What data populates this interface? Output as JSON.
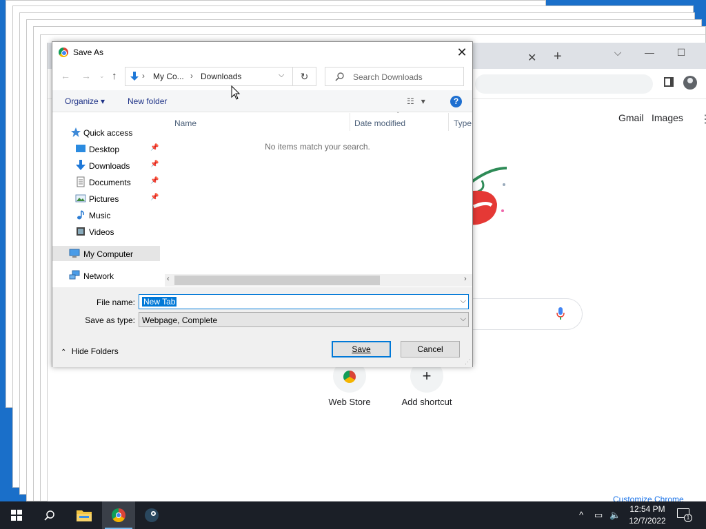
{
  "chrome": {
    "gmail": "Gmail",
    "images": "Images",
    "shortcuts": [
      {
        "label": "Web Store"
      },
      {
        "label": "Add shortcut",
        "glyph": "+"
      }
    ],
    "customize": "Customize Chrome"
  },
  "dialog": {
    "title": "Save As",
    "breadcrumbs": [
      "My Co...",
      "Downloads"
    ],
    "search_placeholder": "Search Downloads",
    "toolbar": {
      "organize": "Organize ▾",
      "new_folder": "New folder",
      "help": "?"
    },
    "nav": [
      {
        "label": "Quick access",
        "icon": "star-icon"
      },
      {
        "label": "Desktop",
        "icon": "desktop-icon",
        "pinned": true
      },
      {
        "label": "Downloads",
        "icon": "download-icon",
        "pinned": true
      },
      {
        "label": "Documents",
        "icon": "documents-icon",
        "pinned": true
      },
      {
        "label": "Pictures",
        "icon": "pictures-icon",
        "pinned": true
      },
      {
        "label": "Music",
        "icon": "music-icon"
      },
      {
        "label": "Videos",
        "icon": "videos-icon"
      },
      {
        "label": "My Computer",
        "icon": "computer-icon",
        "selected": true
      },
      {
        "label": "Network",
        "icon": "network-icon"
      }
    ],
    "columns": [
      "Name",
      "Date modified",
      "Type"
    ],
    "empty_message": "No items match your search.",
    "file_name_label": "File name:",
    "file_name_value": "New Tab",
    "save_type_label": "Save as type:",
    "save_type_value": "Webpage, Complete",
    "hide_folders": "Hide Folders",
    "save_button": "Save",
    "cancel_button": "Cancel"
  },
  "taskbar": {
    "time": "12:54 PM",
    "date": "12/7/2022",
    "notification_count": "1"
  },
  "colors": {
    "accent": "#0078d7",
    "taskbar": "#1b1f27",
    "desktop": "#1a6fc9"
  }
}
